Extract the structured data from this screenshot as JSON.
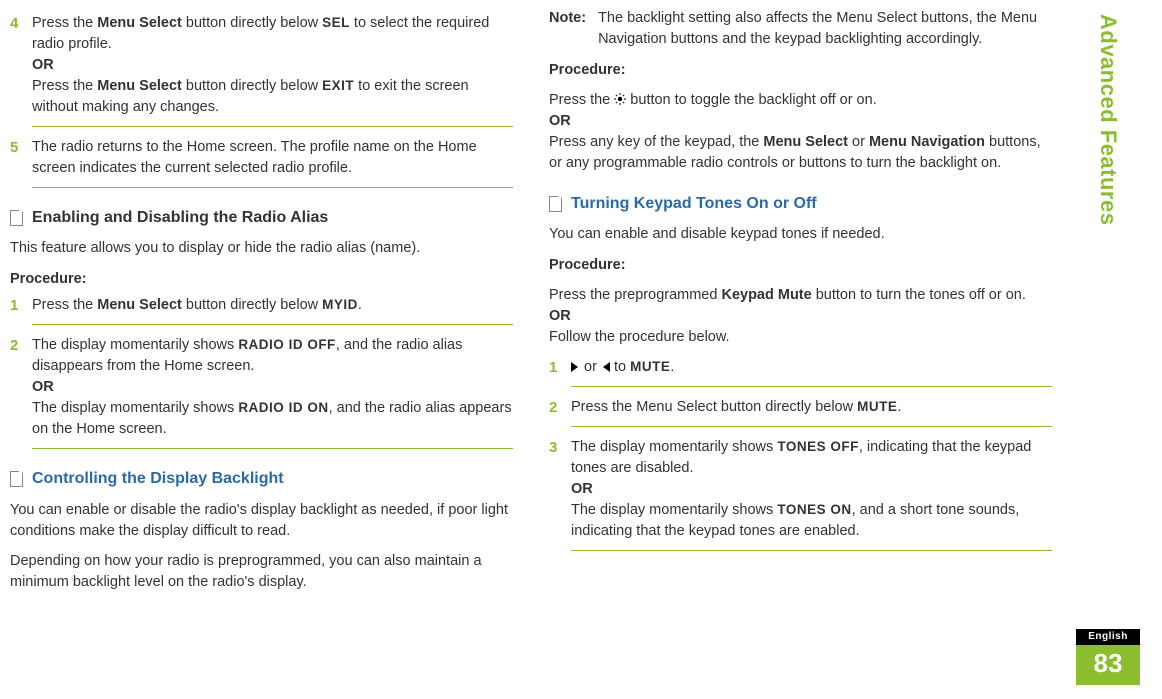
{
  "sidebar": {
    "section_title": "Advanced Features",
    "language": "English",
    "page_number": "83"
  },
  "left": {
    "step4": {
      "num": "4",
      "line1a": "Press the ",
      "line1b": "Menu Select",
      "line1c": " button directly below ",
      "line1d": "SEL",
      "line1e": " to select the required radio profile.",
      "or": "OR",
      "line2a": "Press the ",
      "line2b": "Menu Select",
      "line2c": " button directly below ",
      "line2d": "EXIT",
      "line2e": " to exit the screen without making any changes."
    },
    "step5": {
      "num": "5",
      "text": "The radio returns to the Home screen. The profile name on the Home screen indicates the current selected radio profile."
    },
    "sec1": {
      "title": "Enabling and Disabling the Radio Alias",
      "intro": "This feature allows you to display or hide the radio alias (name).",
      "proc": "Procedure:",
      "s1": {
        "num": "1",
        "a": "Press the ",
        "b": "Menu Select",
        "c": " button directly below ",
        "d": "MYID",
        "e": "."
      },
      "s2": {
        "num": "2",
        "line1a": "The display momentarily shows ",
        "line1b": "RADIO ID OFF",
        "line1c": ", and the radio alias disappears from the Home screen.",
        "or": "OR",
        "line2a": "The display momentarily shows ",
        "line2b": "RADIO ID ON",
        "line2c": ", and the radio alias appears on the Home screen."
      }
    },
    "sec2": {
      "title": "Controlling the Display Backlight",
      "p1": "You can enable or disable the radio's display backlight as needed, if poor light conditions make the display difficult to read.",
      "p2": "Depending on how your radio is preprogrammed, you can also maintain a minimum backlight level on the radio's display."
    }
  },
  "right": {
    "note": {
      "label": "Note:",
      "text": "The backlight setting also affects the Menu Select buttons, the Menu Navigation buttons and the keypad backlighting accordingly."
    },
    "proc": "Procedure:",
    "p1a": "Press the ",
    "p1b": " button to toggle the backlight off or on.",
    "or": "OR",
    "p2a": "Press any key of the keypad, the ",
    "p2b": "Menu Select",
    "p2c": " or ",
    "p2d": "Menu Navigation",
    "p2e": " buttons, or any programmable radio controls or buttons to turn the backlight on.",
    "sec3": {
      "title": "Turning Keypad Tones On or Off",
      "intro": "You can enable and disable keypad tones if needed.",
      "proc": "Procedure:",
      "p1a": "Press the preprogrammed ",
      "p1b": "Keypad Mute",
      "p1c": " button to turn the tones off or on.",
      "or": "OR",
      "p2": "Follow the procedure below.",
      "s1": {
        "num": "1",
        "a": " or ",
        "b": " to ",
        "c": "MUTE",
        "d": "."
      },
      "s2": {
        "num": "2",
        "a": "Press the Menu Select button directly below ",
        "b": "MUTE",
        "c": "."
      },
      "s3": {
        "num": "3",
        "l1a": "The display momentarily shows ",
        "l1b": "TONES OFF",
        "l1c": ", indicating that the keypad tones are disabled.",
        "or": "OR",
        "l2a": "The display momentarily shows ",
        "l2b": "TONES ON",
        "l2c": ", and a short tone sounds, indicating that the keypad tones are enabled."
      }
    }
  }
}
